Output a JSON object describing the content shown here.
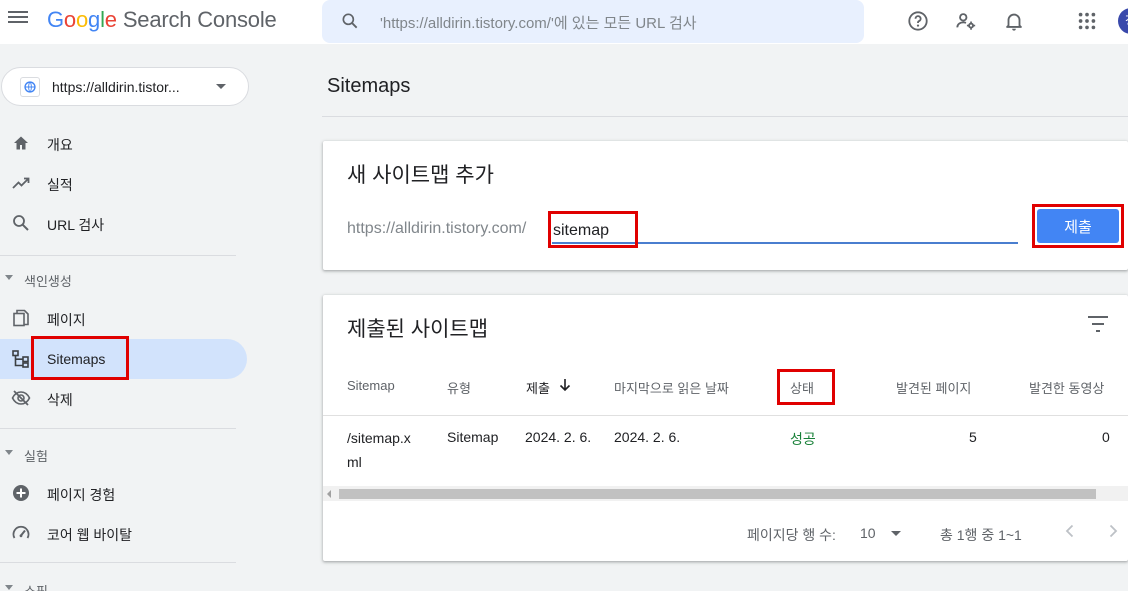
{
  "app": {
    "logo_letters": [
      "G",
      "o",
      "o",
      "g",
      "l",
      "e"
    ],
    "product": "Search Console",
    "search_placeholder": "'https://alldirin.tistory.com/'에 있는 모든 URL 검사",
    "avatar_initial": "청"
  },
  "sidebar": {
    "property": "https://alldirin.tistor...",
    "items_top": [
      {
        "label": "개요",
        "icon": "home-icon"
      },
      {
        "label": "실적",
        "icon": "trending-up-icon"
      },
      {
        "label": "URL 검사",
        "icon": "search-icon"
      }
    ],
    "section_index": "색인생성",
    "items_index": [
      {
        "label": "페이지",
        "icon": "pages-icon"
      },
      {
        "label": "Sitemaps",
        "icon": "sitemap-icon"
      },
      {
        "label": "삭제",
        "icon": "visibility-off-icon"
      }
    ],
    "section_experience": "실험",
    "items_experience": [
      {
        "label": "페이지 경험",
        "icon": "page-experience-icon"
      },
      {
        "label": "코어 웹 바이탈",
        "icon": "speed-icon"
      }
    ],
    "section_shopping": "쇼핑"
  },
  "main": {
    "title": "Sitemaps",
    "add_card": {
      "title": "새 사이트맵 추가",
      "prefix": "https://alldirin.tistory.com/",
      "input_value": "sitemap",
      "submit_label": "제출"
    },
    "list_card": {
      "title": "제출된 사이트맵",
      "columns": [
        "Sitemap",
        "유형",
        "제출",
        "마지막으로 읽은 날짜",
        "상태",
        "발견된 페이지",
        "발견한 동영상"
      ],
      "rows": [
        {
          "sitemap": "/sitemap.xml",
          "type": "Sitemap",
          "submitted": "2024. 2. 6.",
          "last_read": "2024. 2. 6.",
          "status": "성공",
          "pages": "5",
          "videos": "0"
        }
      ],
      "rows_per_page_label": "페이지당 행 수:",
      "rows_per_page": "10",
      "range": "총 1행 중 1~1"
    }
  },
  "colors": {
    "accent": "#4285f4",
    "success": "#188038",
    "highlight": "#e00000",
    "active_nav": "#d2e3fc"
  }
}
